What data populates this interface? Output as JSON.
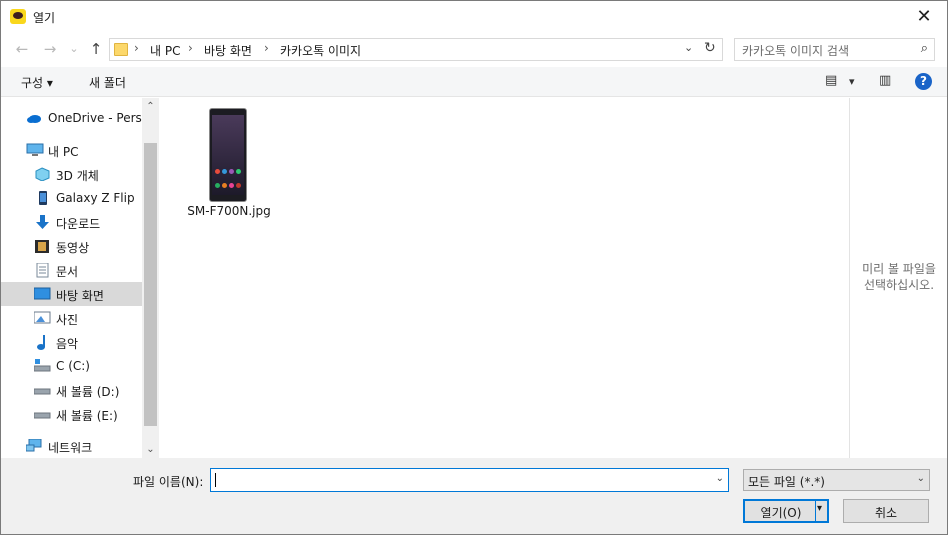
{
  "window": {
    "title": "열기",
    "close_icon": "✕"
  },
  "nav": {
    "back_icon": "←",
    "forward_icon": "→",
    "recent_icon": "⌄",
    "up_icon": "↑"
  },
  "address": {
    "crumbs": [
      "내 PC",
      "바탕 화면",
      "카카오톡 이미지"
    ],
    "separator": "›",
    "dropdown_icon": "⌄",
    "refresh_icon": "↻"
  },
  "search": {
    "placeholder": "카카오톡 이미지 검색",
    "icon": "⌕"
  },
  "toolbar": {
    "organize_label": "구성 ▾",
    "new_folder_label": "새 폴더",
    "view_icon": "▤",
    "view_drop": "▾",
    "pane_icon": "▥",
    "help_label": "?"
  },
  "sidebar": {
    "items": [
      {
        "label": "OneDrive - Personal",
        "icon": "cloud-icon",
        "selected": false
      },
      {
        "label": "내 PC",
        "icon": "pc-icon",
        "selected": false
      },
      {
        "label": "3D 개체",
        "icon": "cube-icon",
        "selected": false
      },
      {
        "label": "Galaxy Z Flip",
        "icon": "phone-icon",
        "selected": false
      },
      {
        "label": "다운로드",
        "icon": "download-icon",
        "selected": false
      },
      {
        "label": "동영상",
        "icon": "video-icon",
        "selected": false
      },
      {
        "label": "문서",
        "icon": "document-icon",
        "selected": false
      },
      {
        "label": "바탕 화면",
        "icon": "desktop-icon",
        "selected": true
      },
      {
        "label": "사진",
        "icon": "picture-icon",
        "selected": false
      },
      {
        "label": "음악",
        "icon": "music-icon",
        "selected": false
      },
      {
        "label": "C (C:)",
        "icon": "drive-icon",
        "selected": false
      },
      {
        "label": "새 볼륨 (D:)",
        "icon": "drive-icon",
        "selected": false
      },
      {
        "label": "새 볼륨 (E:)",
        "icon": "drive-icon",
        "selected": false
      },
      {
        "label": "네트워크",
        "icon": "network-icon",
        "selected": false
      }
    ],
    "scroll_up_icon": "⌃",
    "scroll_down_icon": "⌄"
  },
  "files": [
    {
      "name": "SM-F700N.jpg",
      "icon": "image-thumbnail"
    }
  ],
  "preview": {
    "line1": "미리 볼 파일을",
    "line2": "선택하십시오."
  },
  "footer": {
    "filename_label": "파일 이름(N):",
    "filename_value": "",
    "filename_drop": "⌄",
    "filetype_value": "모든 파일 (*.*)",
    "filetype_drop": "⌄",
    "open_label": "열기(O)",
    "open_arrow": "▾",
    "cancel_label": "취소"
  }
}
